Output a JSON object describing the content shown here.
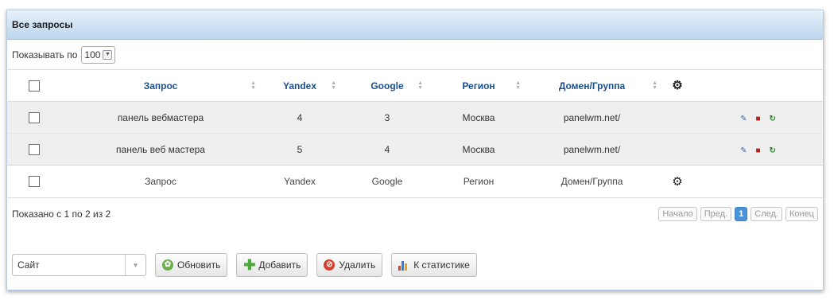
{
  "panel": {
    "title": "Все запросы"
  },
  "length": {
    "label": "Показывать по",
    "value": "100"
  },
  "columns": {
    "query": "Запрос",
    "yandex": "Yandex",
    "google": "Google",
    "region": "Регион",
    "domain": "Домен/Группа"
  },
  "rows": [
    {
      "query": "панель вебмастера",
      "yandex": "4",
      "google": "3",
      "region": "Москва",
      "domain": "panelwm.net/"
    },
    {
      "query": "панель веб мастера",
      "yandex": "5",
      "google": "4",
      "region": "Москва",
      "domain": "panelwm.net/"
    }
  ],
  "footer_columns": {
    "query": "Запрос",
    "yandex": "Yandex",
    "google": "Google",
    "region": "Регион",
    "domain": "Домен/Группа"
  },
  "info": "Показано с 1 по 2 из 2",
  "pager": {
    "first": "Начало",
    "prev": "Пред.",
    "current": "1",
    "next": "След.",
    "last": "Конец"
  },
  "controls": {
    "site_select": "Сайт",
    "refresh": "Обновить",
    "add": "Добавить",
    "delete": "Удалить",
    "stats": "К статистике"
  },
  "icons": {
    "settings": "gear-icon",
    "edit": "pencil-icon",
    "delete": "trash-icon",
    "refresh": "refresh-icon"
  },
  "colors": {
    "header_gradient_top": "#e7f1fa",
    "header_gradient_bottom": "#bcd6ee",
    "link_blue": "#1a4e8a",
    "pager_active": "#4a93d8"
  }
}
